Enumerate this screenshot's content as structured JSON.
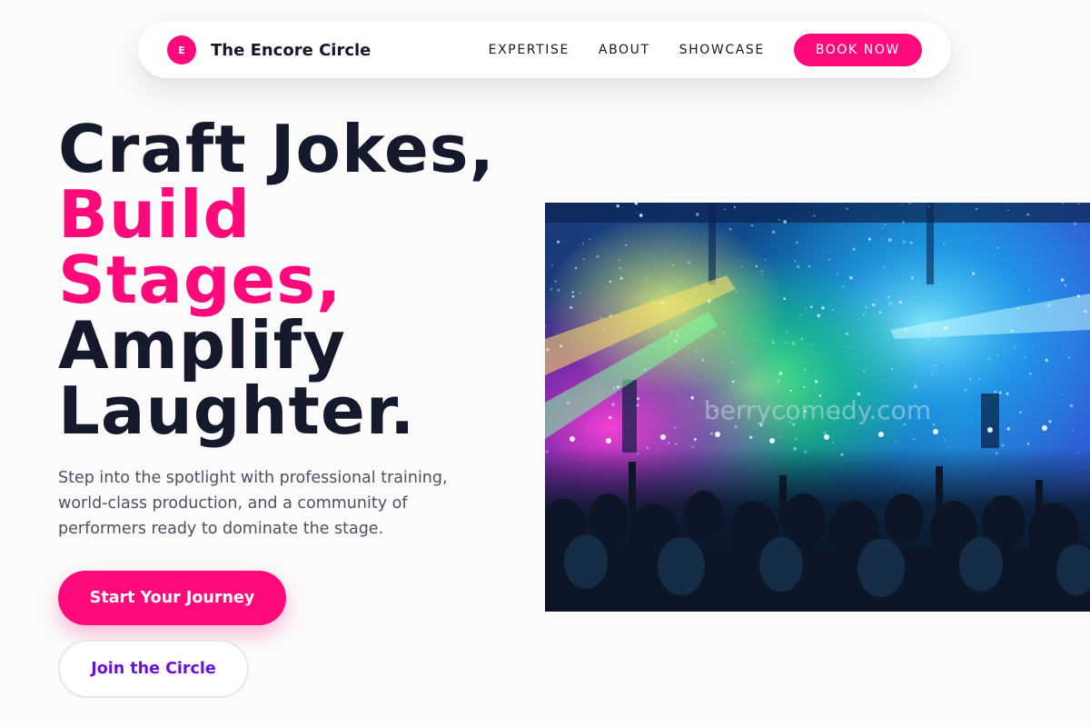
{
  "brand": {
    "logo_letter": "E",
    "name": "The Encore Circle"
  },
  "nav": {
    "links": [
      "EXPERTISE",
      "ABOUT",
      "SHOWCASE"
    ],
    "cta": "BOOK NOW"
  },
  "hero": {
    "title_lines": [
      "Craft Jokes,",
      "Build",
      "Stages,",
      "Amplify",
      "Laughter."
    ],
    "description": "Step into the spotlight with professional training, world-class production, and a community of performers ready to dominate the stage.",
    "primary_button": "Start Your Journey",
    "secondary_button": "Join the Circle"
  },
  "image": {
    "subject": "concert-crowd-stage-lights",
    "watermark": "berrycomedy.com"
  },
  "colors": {
    "accent": "#ff0a7a",
    "text": "#141a2b",
    "muted": "#4b5263",
    "secondary_button_text": "#6a10e0",
    "background": "#fbfbfc"
  }
}
